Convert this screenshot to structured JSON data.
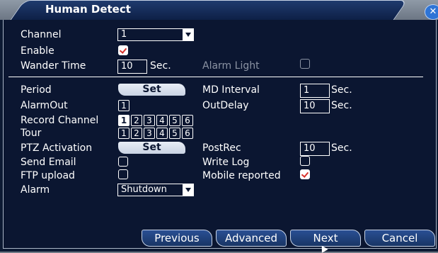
{
  "window": {
    "title": "Human Detect",
    "close_symbol": "✕"
  },
  "channel": {
    "label": "Channel",
    "value": "1"
  },
  "enable": {
    "label": "Enable",
    "checked": true
  },
  "wander_time": {
    "label": "Wander Time",
    "value": "10",
    "unit": "Sec."
  },
  "alarm_light": {
    "label": "Alarm Light",
    "checked": false
  },
  "period": {
    "label": "Period",
    "button": "Set"
  },
  "md_interval": {
    "label": "MD Interval",
    "value": "1",
    "unit": "Sec."
  },
  "alarm_out": {
    "label": "AlarmOut",
    "boxes": [
      "1"
    ]
  },
  "out_delay": {
    "label": "OutDelay",
    "value": "10",
    "unit": "Sec."
  },
  "record_channel": {
    "label": "Record Channel",
    "boxes": [
      "1",
      "2",
      "3",
      "4",
      "5",
      "6"
    ],
    "selected": "1"
  },
  "tour": {
    "label": "Tour",
    "boxes": [
      "1",
      "2",
      "3",
      "4",
      "5",
      "6"
    ]
  },
  "ptz_activation": {
    "label": "PTZ Activation",
    "button": "Set"
  },
  "post_rec": {
    "label": "PostRec",
    "value": "10",
    "unit": "Sec."
  },
  "send_email": {
    "label": "Send Email",
    "checked": false
  },
  "write_log": {
    "label": "Write Log",
    "checked": false
  },
  "ftp_upload": {
    "label": "FTP upload",
    "checked": false
  },
  "mobile_reported": {
    "label": "Mobile reported",
    "checked": true
  },
  "alarm": {
    "label": "Alarm",
    "value": "Shutdown"
  },
  "footer": {
    "previous": "Previous",
    "advanced": "Advanced",
    "next": "Next",
    "cancel": "Cancel"
  },
  "colors": {
    "background": "#0b1631",
    "accent": "#2e74d6",
    "check": "#d8312b"
  }
}
